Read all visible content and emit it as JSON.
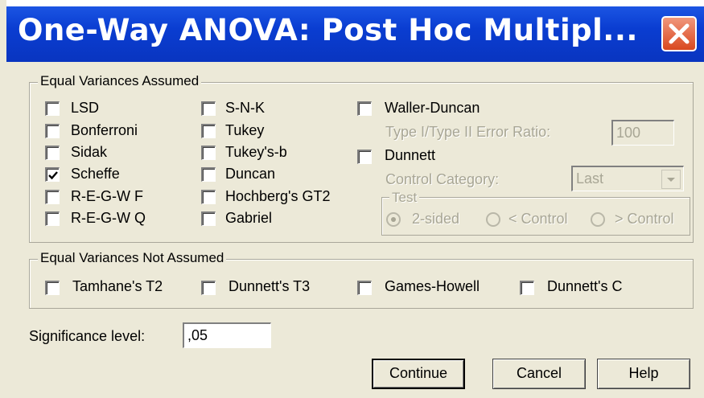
{
  "window": {
    "title": "One-Way ANOVA: Post Hoc Multipl...",
    "close_glyph": "✕"
  },
  "equal_assumed": {
    "legend": "Equal Variances Assumed",
    "col1": [
      {
        "label": "LSD",
        "checked": false
      },
      {
        "label": "Bonferroni",
        "checked": false
      },
      {
        "label": "Sidak",
        "checked": false
      },
      {
        "label": "Scheffe",
        "checked": true
      },
      {
        "label": "R-E-G-W F",
        "checked": false
      },
      {
        "label": "R-E-G-W Q",
        "checked": false
      }
    ],
    "col2": [
      {
        "label": "S-N-K",
        "checked": false
      },
      {
        "label": "Tukey",
        "checked": false
      },
      {
        "label": "Tukey's-b",
        "checked": false
      },
      {
        "label": "Duncan",
        "checked": false
      },
      {
        "label": "Hochberg's GT2",
        "checked": false
      },
      {
        "label": "Gabriel",
        "checked": false
      }
    ],
    "waller_duncan": {
      "label": "Waller-Duncan",
      "checked": false
    },
    "error_ratio": {
      "label": "Type I/Type II Error Ratio:",
      "value": "100"
    },
    "dunnett": {
      "label": "Dunnett",
      "checked": false
    },
    "control_category": {
      "label": "Control Category:",
      "value": "Last"
    },
    "test": {
      "legend": "Test",
      "options": [
        {
          "label": "2-sided",
          "selected": true
        },
        {
          "label": "< Control",
          "selected": false
        },
        {
          "label": "> Control",
          "selected": false
        }
      ]
    }
  },
  "equal_not_assumed": {
    "legend": "Equal Variances Not Assumed",
    "items": [
      {
        "label": "Tamhane's T2",
        "checked": false
      },
      {
        "label": "Dunnett's T3",
        "checked": false
      },
      {
        "label": "Games-Howell",
        "checked": false
      },
      {
        "label": "Dunnett's C",
        "checked": false
      }
    ]
  },
  "significance": {
    "label": "Significance level:",
    "value": ",05"
  },
  "buttons": {
    "continue": "Continue",
    "cancel": "Cancel",
    "help": "Help"
  }
}
